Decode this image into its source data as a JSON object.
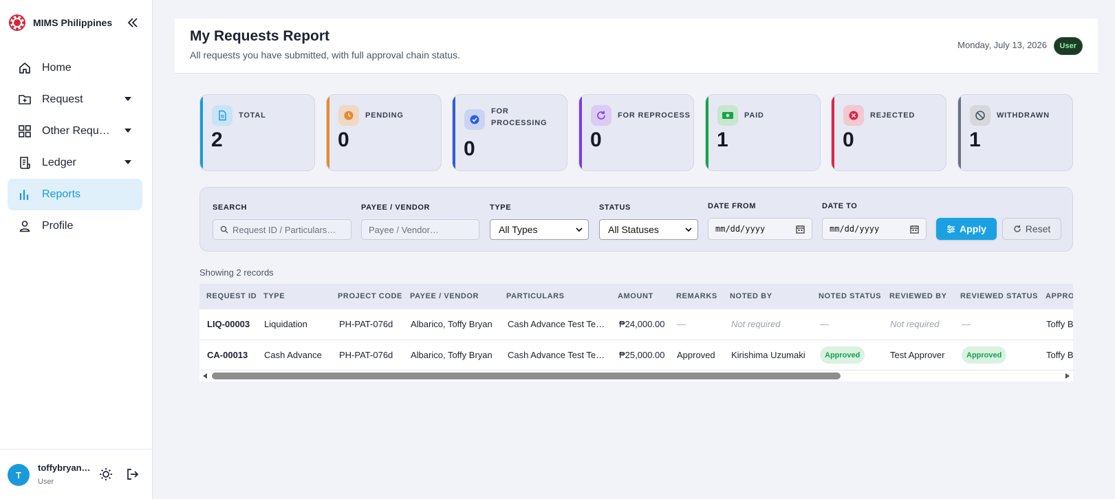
{
  "brand": {
    "name": "MIMS Philippines"
  },
  "sidebar": {
    "items": [
      {
        "label": "Home",
        "icon": "home-icon"
      },
      {
        "label": "Request",
        "icon": "folder-plus-icon"
      },
      {
        "label": "Other Requests",
        "icon": "grid-icon"
      },
      {
        "label": "Ledger",
        "icon": "ledger-icon"
      },
      {
        "label": "Reports",
        "icon": "bar-chart-icon",
        "active": true
      },
      {
        "label": "Profile",
        "icon": "user-icon"
      }
    ]
  },
  "user": {
    "initial": "T",
    "name": "toffybryan…",
    "role": "User"
  },
  "header": {
    "title": "My Requests Report",
    "subtitle": "All requests you have submitted, with full approval chain status.",
    "date": "Monday, July 13, 2026",
    "role_badge": "User"
  },
  "stats": [
    {
      "label": "TOTAL",
      "value": "2",
      "color": "#1a9ad9"
    },
    {
      "label": "PENDING",
      "value": "0",
      "color": "#e8892b"
    },
    {
      "label": "FOR PROCESSING",
      "value": "0",
      "color": "#2f5fd6"
    },
    {
      "label": "FOR REPROCESS",
      "value": "0",
      "color": "#7c3aed"
    },
    {
      "label": "PAID",
      "value": "1",
      "color": "#16a34a"
    },
    {
      "label": "REJECTED",
      "value": "0",
      "color": "#dc2646"
    },
    {
      "label": "WITHDRAWN",
      "value": "1",
      "color": "#6b7280"
    }
  ],
  "filters": {
    "search_label": "SEARCH",
    "search_placeholder": "Request ID / Particulars…",
    "payee_label": "PAYEE / VENDOR",
    "payee_placeholder": "Payee / Vendor…",
    "type_label": "TYPE",
    "type_value": "All Types",
    "status_label": "STATUS",
    "status_value": "All Statuses",
    "date_from_label": "DATE FROM",
    "date_from_value": "mm/dd/yyyy",
    "date_to_label": "DATE TO",
    "date_to_value": "mm/dd/yyyy",
    "apply_label": "Apply",
    "reset_label": "Reset"
  },
  "record_count": "Showing 2 records",
  "table": {
    "headers": [
      "REQUEST ID",
      "TYPE",
      "PROJECT CODE",
      "PAYEE / VENDOR",
      "PARTICULARS",
      "AMOUNT",
      "REMARKS",
      "NOTED BY",
      "NOTED STATUS",
      "REVIEWED BY",
      "REVIEWED STATUS",
      "APPRO"
    ],
    "rows": [
      {
        "request_id": "LIQ-00003",
        "type": "Liquidation",
        "project_code": "PH-PAT-076d",
        "payee": "Albarico, Toffy Bryan",
        "particulars": "Cash Advance Test Te…",
        "amount": "₱24,000.00",
        "remarks": "—",
        "noted_by": "Not required",
        "noted_status": "—",
        "reviewed_by": "Not required",
        "reviewed_status": "—",
        "approved_by": "Toffy B"
      },
      {
        "request_id": "CA-00013",
        "type": "Cash Advance",
        "project_code": "PH-PAT-076d",
        "payee": "Albarico, Toffy Bryan",
        "particulars": "Cash Advance Test Te…",
        "amount": "₱25,000.00",
        "remarks": "Approved",
        "noted_by": "Kirishima Uzumaki",
        "noted_status": "Approved",
        "reviewed_by": "Test Approver",
        "reviewed_status": "Approved",
        "approved_by": "Toffy B"
      }
    ]
  }
}
